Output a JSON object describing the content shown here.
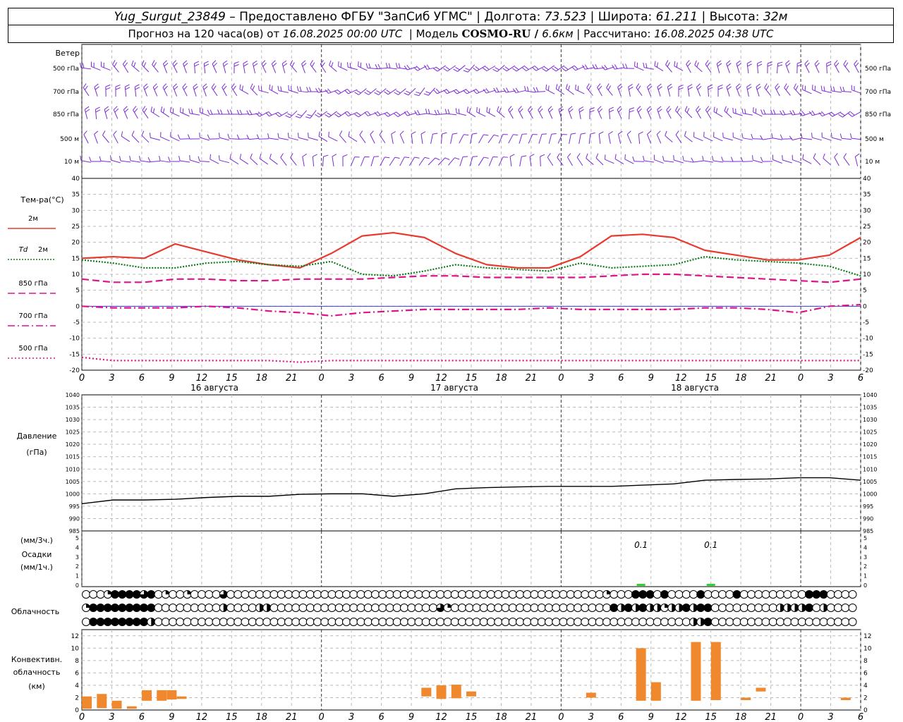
{
  "header": {
    "line1": {
      "station": "Yug_Surgut_23849",
      "provider": " – Предоставлено ФГБУ \"ЗапСиб УГМС\" | Долгота: ",
      "lon": "73.523",
      "lat_label": " | Широта: ",
      "lat": "61.211",
      "alt_label": " | Высота: ",
      "alt": "32м"
    },
    "line2": {
      "forecast": "Прогноз на 120 часа(ов) от ",
      "start": "16.08.2025 00:00 UTC",
      "model_label": "  | Модель ",
      "model": "COSMO-RU / ",
      "res": "6.6км",
      "calc_label": " | Рассчитано: ",
      "calc": "16.08.2025 04:38 UTC"
    }
  },
  "chart_data": [
    {
      "type": "wind-barbs",
      "title": "Ветер",
      "levels": [
        "500 гПа",
        "700 гПа",
        "850 гПа",
        "500 м",
        "10 м"
      ],
      "color": "#7b2ad6"
    },
    {
      "type": "line",
      "title": "Тем-ра(°С)",
      "ylim": [
        -20,
        40
      ],
      "yticks": [
        -20,
        -15,
        -10,
        -5,
        0,
        5,
        10,
        15,
        20,
        25,
        30,
        35,
        40
      ],
      "x_hours": [
        0,
        6,
        12,
        18,
        24,
        30,
        36,
        42,
        48,
        54,
        60,
        66,
        72,
        78,
        84,
        90,
        96,
        102,
        108,
        114,
        120
      ],
      "x_tick_labels": [
        "0",
        "3",
        "6",
        "9",
        "12",
        "15",
        "18",
        "21",
        "0",
        "3",
        "6",
        "9",
        "12",
        "15",
        "18",
        "21",
        "0",
        "3",
        "6",
        "9",
        "12",
        "15",
        "18",
        "21",
        "0",
        "3",
        "6"
      ],
      "day_labels": [
        "16 августа",
        "17 августа",
        "18 августа"
      ],
      "series": [
        {
          "name": "2м",
          "color": "#e83a2e",
          "dash": "solid",
          "values": [
            15,
            15.5,
            15,
            19.5,
            17,
            14.5,
            13,
            12,
            16.5,
            22,
            23,
            21.5,
            16.5,
            13,
            12,
            12,
            15.5,
            22,
            22.5,
            21.5,
            17.5,
            16,
            14.5,
            14.5,
            16,
            21.5
          ]
        },
        {
          "name": "Td 2м",
          "color": "#0d7a1d",
          "dash": "dot",
          "values": [
            14.5,
            13.5,
            12,
            12,
            13.5,
            14,
            13,
            12.5,
            14,
            10,
            9.5,
            11,
            13,
            12,
            11.5,
            11,
            13.5,
            12,
            12.5,
            13,
            15.5,
            14.5,
            14,
            13.5,
            12.5,
            9.5
          ]
        },
        {
          "name": "850 гПа",
          "color": "#e0138a",
          "dash": "dash",
          "values": [
            8.5,
            7.5,
            7.5,
            8.5,
            8.5,
            8,
            8,
            8.5,
            8.5,
            8.5,
            9,
            9.5,
            9.5,
            9,
            9,
            9,
            9,
            9.5,
            10,
            10,
            9.5,
            9,
            8.5,
            8,
            7.5,
            8.5
          ]
        },
        {
          "name": "700 гПа",
          "color": "#e0138a",
          "dash": "dashdot",
          "values": [
            0,
            -0.5,
            -0.5,
            -0.5,
            0,
            -0.5,
            -1.5,
            -2,
            -3,
            -2,
            -1.5,
            -1,
            -1,
            -1,
            -1,
            -0.5,
            -1,
            -1,
            -1,
            -1,
            -0.5,
            -0.5,
            -1,
            -2,
            0,
            0.5
          ]
        },
        {
          "name": "500 гПа",
          "color": "#e0138a",
          "dash": "dotted",
          "values": [
            -16,
            -17,
            -17,
            -17,
            -17,
            -17,
            -17,
            -17.5,
            -17,
            -17,
            -17,
            -17,
            -17,
            -17,
            -17,
            -17,
            -17,
            -17,
            -17,
            -17,
            -17,
            -17,
            -17,
            -17,
            -17,
            -17
          ]
        }
      ]
    },
    {
      "type": "line",
      "title": "Давление",
      "unit": "(гПа)",
      "ylim": [
        985,
        1040
      ],
      "yticks": [
        985,
        990,
        995,
        1000,
        1005,
        1010,
        1015,
        1020,
        1025,
        1030,
        1035,
        1040
      ],
      "series": [
        {
          "name": "Давление",
          "color": "#000000",
          "values": [
            996,
            997.5,
            997.5,
            997.8,
            998.5,
            999,
            999,
            999.8,
            1000,
            1000,
            999,
            1000,
            1002,
            1002.5,
            1002.8,
            1003,
            1003,
            1003,
            1003.5,
            1004,
            1005.5,
            1005.8,
            1006,
            1006.5,
            1006.5,
            1005.5
          ]
        }
      ]
    },
    {
      "type": "bar",
      "title": "Осадки",
      "unit_top": "(мм/3ч.)",
      "unit_bottom": "(мм/1ч.)",
      "ylim": [
        0,
        5
      ],
      "yticks": [
        0,
        1,
        2,
        3,
        4,
        5
      ],
      "bars": [
        {
          "hour": 56,
          "value": 0.1,
          "label": "0.1"
        },
        {
          "hour": 63,
          "value": 0.1,
          "label": "0.1"
        }
      ]
    },
    {
      "type": "cloud-symbols",
      "title": "Облачность",
      "rows": [
        "00014444340100100003000000000000000000000000000000000000000000000000000010004440400004000040000000004440000",
        "14444444440000000002000022000000000000000000000003100000000000000000000004242422122424400000000022224020000",
        "04444444420000000000000000000000000000000000000000000000000000000000000000000000000022400000000000000000000"
      ]
    },
    {
      "type": "bar",
      "title": "Конвективн. облачность",
      "unit": "(км)",
      "ylim": [
        0,
        13
      ],
      "yticks": [
        0,
        2,
        4,
        6,
        8,
        10,
        12
      ],
      "color": "#f0892e",
      "bars": [
        {
          "hour": 0.5,
          "base": 0.2,
          "top": 2.2
        },
        {
          "hour": 2,
          "base": 0.3,
          "top": 2.6
        },
        {
          "hour": 3.5,
          "base": 0.2,
          "top": 1.5
        },
        {
          "hour": 5,
          "base": 0.2,
          "top": 0.6
        },
        {
          "hour": 6.5,
          "base": 1.5,
          "top": 3.2
        },
        {
          "hour": 8,
          "base": 1.5,
          "top": 3.2
        },
        {
          "hour": 9,
          "base": 1.7,
          "top": 3.2
        },
        {
          "hour": 10,
          "base": 1.8,
          "top": 2.2
        },
        {
          "hour": 34.5,
          "base": 2.2,
          "top": 3.6
        },
        {
          "hour": 36,
          "base": 1.8,
          "top": 4.0
        },
        {
          "hour": 37.5,
          "base": 1.9,
          "top": 4.1
        },
        {
          "hour": 39,
          "base": 2.2,
          "top": 3.0
        },
        {
          "hour": 51,
          "base": 2.0,
          "top": 2.8
        },
        {
          "hour": 56,
          "base": 1.5,
          "top": 10.0
        },
        {
          "hour": 57.5,
          "base": 1.5,
          "top": 4.5
        },
        {
          "hour": 61.5,
          "base": 1.5,
          "top": 11.0
        },
        {
          "hour": 63.5,
          "base": 1.6,
          "top": 11.0
        },
        {
          "hour": 66.5,
          "base": 1.6,
          "top": 2.0
        },
        {
          "hour": 68,
          "base": 3.0,
          "top": 3.6
        },
        {
          "hour": 76.5,
          "base": 1.6,
          "top": 2.0
        }
      ]
    }
  ]
}
